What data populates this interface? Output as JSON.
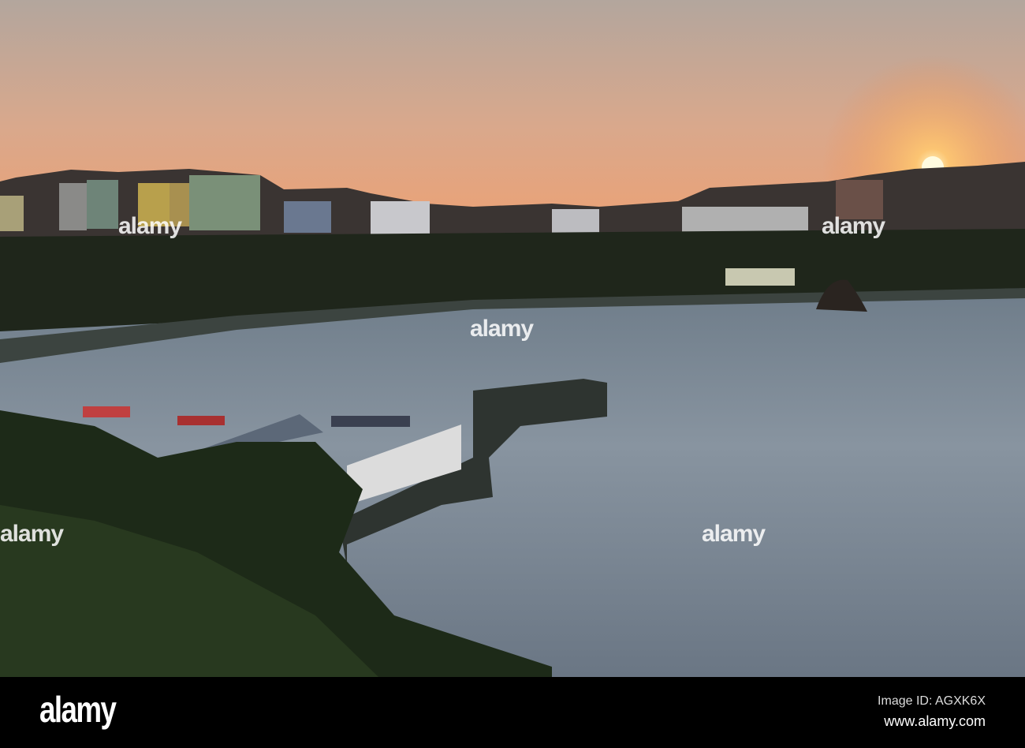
{
  "photo": {
    "subject": "harbour at sunset",
    "colors": {
      "sky_top": "#b4a69c",
      "sky_horizon": "#f0a878",
      "sun": "#fff4c0",
      "water": "#7e8b98",
      "cliff": "#1e2418",
      "foliage": "#2a3a20"
    }
  },
  "watermark": {
    "text": "alamy"
  },
  "footer": {
    "logo": "alamy",
    "image_id": "Image ID: AGXK6X",
    "url": "www.alamy.com"
  }
}
